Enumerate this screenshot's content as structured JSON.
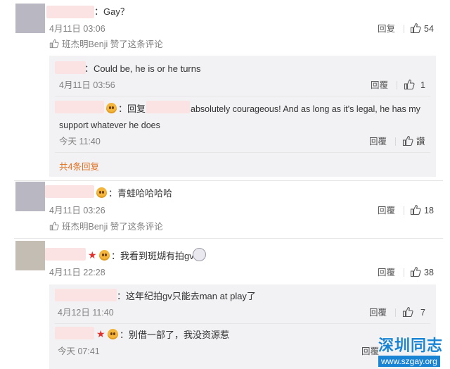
{
  "comments": [
    {
      "text": "：Gay？",
      "time": "4月11日 03:06",
      "reply_label": "回复",
      "like_count": "54",
      "liked_by": "班杰明Benji 赞了这条评论",
      "replies": [
        {
          "text": "：Could be, he is or he turns",
          "time": "4月11日 03:56",
          "reply_label": "回覆",
          "like_count": "1"
        },
        {
          "text_prefix": "：回复",
          "text_line1": "absolutely courageous! And as long as it's legal, he has my",
          "text_line2": "support whatever he does",
          "time": "今天 11:40",
          "reply_label": "回覆",
          "like_label": "讚"
        }
      ],
      "more_replies": "共4条回复"
    },
    {
      "text": "：青蛙哈哈哈哈",
      "time": "4月11日 03:26",
      "reply_label": "回覆",
      "like_count": "18",
      "liked_by": "班杰明Benji 赞了这条评论"
    },
    {
      "text": "：我看到斑煳有拍gv",
      "time": "4月11日 22:28",
      "reply_label": "回覆",
      "like_count": "38",
      "replies": [
        {
          "text": "：这年纪拍gv只能去man at play了",
          "time": "4月12日 11:40",
          "reply_label": "回覆",
          "like_count": "7"
        },
        {
          "text": "：别借一部了，我没资源惹",
          "time": "今天 07:41",
          "reply_label": "回覆"
        }
      ]
    }
  ],
  "watermark": {
    "title": "深圳同志",
    "url": "www.szgay.org"
  },
  "colors": {
    "accent_more": "#e36e1c",
    "watermark": "#1a84d4",
    "blur": "#fbe3e3",
    "star": "#e0322b"
  }
}
